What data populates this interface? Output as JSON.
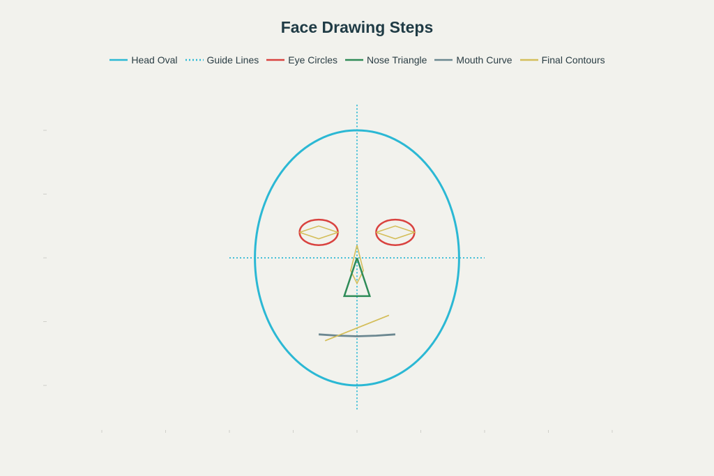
{
  "title": "Face Drawing Steps",
  "colors": {
    "head": "#2bb8d4",
    "guide": "#2bb8d4",
    "eyes": "#d9423f",
    "nose": "#2e8b57",
    "mouth": "#6b8790",
    "contours": "#d4be5a",
    "background": "#f2f2ed",
    "tick": "#cfcfc9"
  },
  "legend": [
    {
      "label": "Head Oval",
      "color": "#2bb8d4",
      "dash": false
    },
    {
      "label": "Guide Lines",
      "color": "#2bb8d4",
      "dash": true
    },
    {
      "label": "Eye Circles",
      "color": "#d9423f",
      "dash": false
    },
    {
      "label": "Nose Triangle",
      "color": "#2e8b57",
      "dash": false
    },
    {
      "label": "Mouth Curve",
      "color": "#6b8790",
      "dash": false
    },
    {
      "label": "Final Contours",
      "color": "#d4be5a",
      "dash": false
    }
  ],
  "chart_data": {
    "type": "line",
    "title": "Face Drawing Steps",
    "xlim": [
      -5,
      5
    ],
    "ylim": [
      -5,
      5
    ],
    "grid": false,
    "legend_position": "top",
    "series": [
      {
        "name": "Head Oval",
        "shape": "ellipse",
        "center": [
          0,
          0
        ],
        "rx": 1.6,
        "ry": 2.0
      },
      {
        "name": "Guide Lines",
        "lines": [
          [
            [
              0,
              2.4
            ],
            [
              0,
              -2.4
            ]
          ],
          [
            [
              -2.0,
              0
            ],
            [
              2.0,
              0
            ]
          ]
        ]
      },
      {
        "name": "Eye Circles",
        "shape": "ellipses",
        "items": [
          {
            "center": [
              -0.6,
              0.4
            ],
            "rx": 0.3,
            "ry": 0.2
          },
          {
            "center": [
              0.6,
              0.4
            ],
            "rx": 0.3,
            "ry": 0.2
          }
        ]
      },
      {
        "name": "Nose Triangle",
        "points": [
          [
            0,
            0
          ],
          [
            -0.2,
            -0.6
          ],
          [
            0.2,
            -0.6
          ],
          [
            0,
            0
          ]
        ]
      },
      {
        "name": "Mouth Curve",
        "points": [
          [
            -0.6,
            -1.2
          ],
          [
            -0.3,
            -1.22
          ],
          [
            0,
            -1.23
          ],
          [
            0.3,
            -1.22
          ],
          [
            0.6,
            -1.2
          ]
        ]
      },
      {
        "name": "Final Contours",
        "groups": [
          [
            [
              -0.9,
              0.4
            ],
            [
              -0.6,
              0.5
            ],
            [
              -0.3,
              0.4
            ],
            [
              -0.6,
              0.3
            ],
            [
              -0.9,
              0.4
            ]
          ],
          [
            [
              0.3,
              0.4
            ],
            [
              0.6,
              0.5
            ],
            [
              0.9,
              0.4
            ],
            [
              0.6,
              0.3
            ],
            [
              0.3,
              0.4
            ]
          ],
          [
            [
              0,
              0.2
            ],
            [
              -0.1,
              -0.2
            ],
            [
              0,
              -0.4
            ],
            [
              0.1,
              -0.2
            ],
            [
              0,
              0.2
            ]
          ],
          [
            [
              -0.5,
              -1.3
            ],
            [
              0.5,
              -0.9
            ]
          ]
        ]
      }
    ]
  }
}
